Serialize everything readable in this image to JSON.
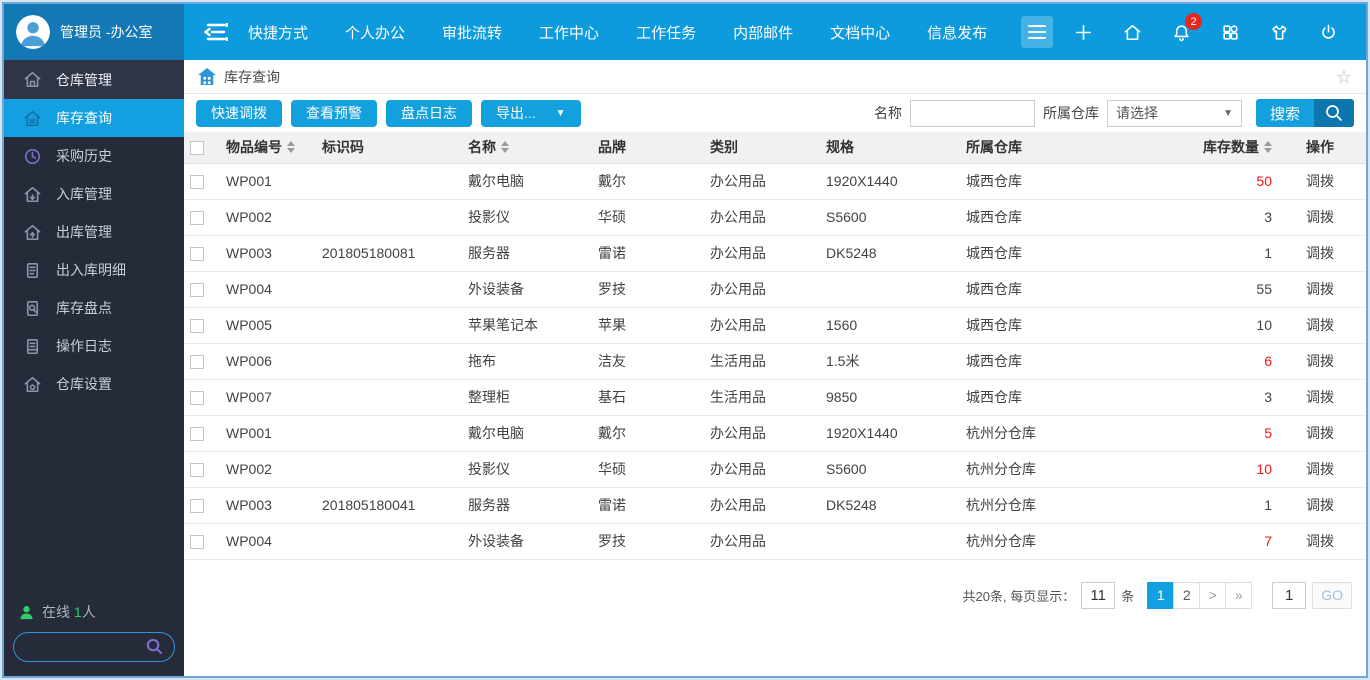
{
  "topbar": {
    "user_name": "管理员 -办公室",
    "nav_items": [
      "快捷方式",
      "个人办公",
      "审批流转",
      "工作中心",
      "工作任务",
      "内部邮件",
      "文档中心",
      "信息发布"
    ],
    "notification_count": "2",
    "right_icons": [
      "plus-icon",
      "home-icon",
      "bell-icon",
      "apps-icon",
      "tshirt-icon",
      "power-icon"
    ]
  },
  "sidebar": {
    "items": [
      {
        "label": "仓库管理",
        "icon": "warehouse-icon",
        "header": true
      },
      {
        "label": "库存查询",
        "icon": "inventory-search-icon",
        "active": true
      },
      {
        "label": "采购历史",
        "icon": "clock-icon",
        "icon_color": "#7a6fd0"
      },
      {
        "label": "入库管理",
        "icon": "inbound-house-icon"
      },
      {
        "label": "出库管理",
        "icon": "outbound-house-icon"
      },
      {
        "label": "出入库明细",
        "icon": "detail-doc-icon"
      },
      {
        "label": "库存盘点",
        "icon": "stocktake-icon"
      },
      {
        "label": "操作日志",
        "icon": "log-icon"
      },
      {
        "label": "仓库设置",
        "icon": "settings-house-icon"
      }
    ],
    "online_prefix": "在线",
    "online_count": "1",
    "online_suffix": "人"
  },
  "breadcrumb": {
    "title": "库存查询"
  },
  "toolbar": {
    "action_buttons": [
      "快速调拨",
      "查看预警",
      "盘点日志"
    ],
    "export_button": "导出...",
    "name_label": "名称",
    "name_value": "",
    "warehouse_label": "所属仓库",
    "warehouse_value": "请选择",
    "search_button": "搜索"
  },
  "table": {
    "headers": [
      {
        "label": "物品编号",
        "sortable": true
      },
      {
        "label": "标识码",
        "sortable": false
      },
      {
        "label": "名称",
        "sortable": true
      },
      {
        "label": "品牌",
        "sortable": false
      },
      {
        "label": "类别",
        "sortable": false
      },
      {
        "label": "规格",
        "sortable": false
      },
      {
        "label": "所属仓库",
        "sortable": false
      },
      {
        "label": "库存数量",
        "sortable": true
      },
      {
        "label": "操作",
        "sortable": false
      }
    ],
    "action_label": "调拨",
    "rows": [
      {
        "item_no": "WP001",
        "code": "",
        "name": "戴尔电脑",
        "brand": "戴尔",
        "category": "办公用品",
        "spec": "1920X1440",
        "warehouse": "城西仓库",
        "qty": "50",
        "qty_low": true
      },
      {
        "item_no": "WP002",
        "code": "",
        "name": "投影仪",
        "brand": "华硕",
        "category": "办公用品",
        "spec": "S5600",
        "warehouse": "城西仓库",
        "qty": "3",
        "qty_low": false
      },
      {
        "item_no": "WP003",
        "code": "201805180081",
        "name": "服务器",
        "brand": "雷诺",
        "category": "办公用品",
        "spec": "DK5248",
        "warehouse": "城西仓库",
        "qty": "1",
        "qty_low": false
      },
      {
        "item_no": "WP004",
        "code": "",
        "name": "外设装备",
        "brand": "罗技",
        "category": "办公用品",
        "spec": "",
        "warehouse": "城西仓库",
        "qty": "55",
        "qty_low": false
      },
      {
        "item_no": "WP005",
        "code": "",
        "name": "苹果笔记本",
        "brand": "苹果",
        "category": "办公用品",
        "spec": "1560",
        "warehouse": "城西仓库",
        "qty": "10",
        "qty_low": false
      },
      {
        "item_no": "WP006",
        "code": "",
        "name": "拖布",
        "brand": "洁友",
        "category": "生活用品",
        "spec": "1.5米",
        "warehouse": "城西仓库",
        "qty": "6",
        "qty_low": true
      },
      {
        "item_no": "WP007",
        "code": "",
        "name": "整理柜",
        "brand": "基石",
        "category": "生活用品",
        "spec": "9850",
        "warehouse": "城西仓库",
        "qty": "3",
        "qty_low": false
      },
      {
        "item_no": "WP001",
        "code": "",
        "name": "戴尔电脑",
        "brand": "戴尔",
        "category": "办公用品",
        "spec": "1920X1440",
        "warehouse": "杭州分仓库",
        "qty": "5",
        "qty_low": true
      },
      {
        "item_no": "WP002",
        "code": "",
        "name": "投影仪",
        "brand": "华硕",
        "category": "办公用品",
        "spec": "S5600",
        "warehouse": "杭州分仓库",
        "qty": "10",
        "qty_low": true
      },
      {
        "item_no": "WP003",
        "code": "201805180041",
        "name": "服务器",
        "brand": "雷诺",
        "category": "办公用品",
        "spec": "DK5248",
        "warehouse": "杭州分仓库",
        "qty": "1",
        "qty_low": false
      },
      {
        "item_no": "WP004",
        "code": "",
        "name": "外设装备",
        "brand": "罗技",
        "category": "办公用品",
        "spec": "",
        "warehouse": "杭州分仓库",
        "qty": "7",
        "qty_low": true
      }
    ]
  },
  "pagination": {
    "summary": "共20条, 每页显示：",
    "page_size": "11",
    "unit_label": "条",
    "pages": [
      {
        "label": "1",
        "active": true
      },
      {
        "label": "2",
        "active": false
      },
      {
        "label": ">",
        "active": false,
        "arrow": true
      },
      {
        "label": "»",
        "active": false,
        "arrow": true
      }
    ],
    "goto_value": "1",
    "go_label": "GO"
  },
  "colors": {
    "accent_blue": "#14a0dd",
    "topbar_blue": "#0d9bdd",
    "topbar_left_blue": "#1478b5",
    "sidebar_dark": "#262b39",
    "low_stock_red": "#f51515",
    "badge_red": "#e8261f",
    "online_green": "#2ecf66"
  }
}
